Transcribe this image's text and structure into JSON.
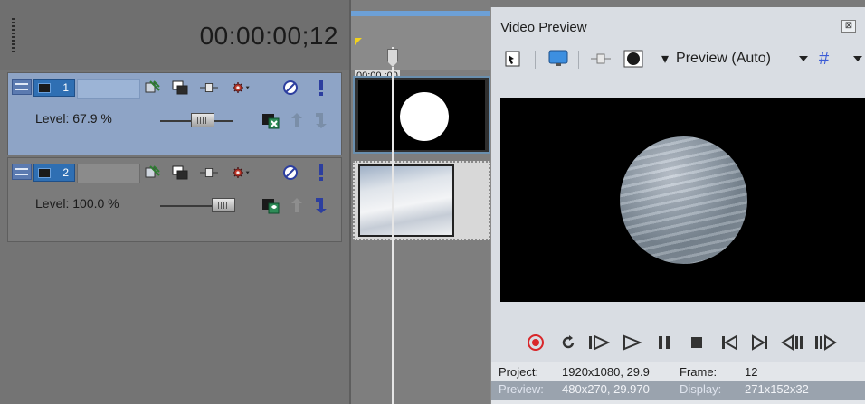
{
  "timeline": {
    "timecode": "00:00:00;12",
    "ruler_label": "00:00 :00"
  },
  "tracks": [
    {
      "number": "1",
      "level_label": "Level:  67.9 %",
      "level": 0.679,
      "selected": true
    },
    {
      "number": "2",
      "level_label": "Level: 100.0 %",
      "level": 1.0,
      "selected": false
    }
  ],
  "preview": {
    "title": "Video Preview",
    "close_glyph": "⊠",
    "quality": "Preview (Auto)",
    "grid_glyph": "#",
    "status": {
      "project_label": "Project:",
      "project_value": "1920x1080, 29.9",
      "frame_label": "Frame:",
      "frame_value": "12",
      "preview_label": "Preview:",
      "preview_value": "480x270, 29.970",
      "display_label": "Display:",
      "display_value": "271x152x32"
    }
  },
  "colors": {
    "selected_track": "#8ea4c6",
    "track_number_bg": "#2f6fb3",
    "record_red": "#d9262a",
    "grid_blue": "#3b5bd6"
  },
  "icons": {
    "track": [
      "minimize-icon",
      "film-icon",
      "fx-icon",
      "compositing-icon",
      "keyframe-icon",
      "gear-icon",
      "mute-icon",
      "solo-icon",
      "mask-icon",
      "parent-up-icon",
      "child-down-icon"
    ],
    "transport": [
      "record-icon",
      "loop-icon",
      "play-from-start-icon",
      "play-icon",
      "pause-icon",
      "stop-icon",
      "go-to-start-icon",
      "go-to-end-icon",
      "previous-frame-icon",
      "next-frame-icon"
    ]
  }
}
